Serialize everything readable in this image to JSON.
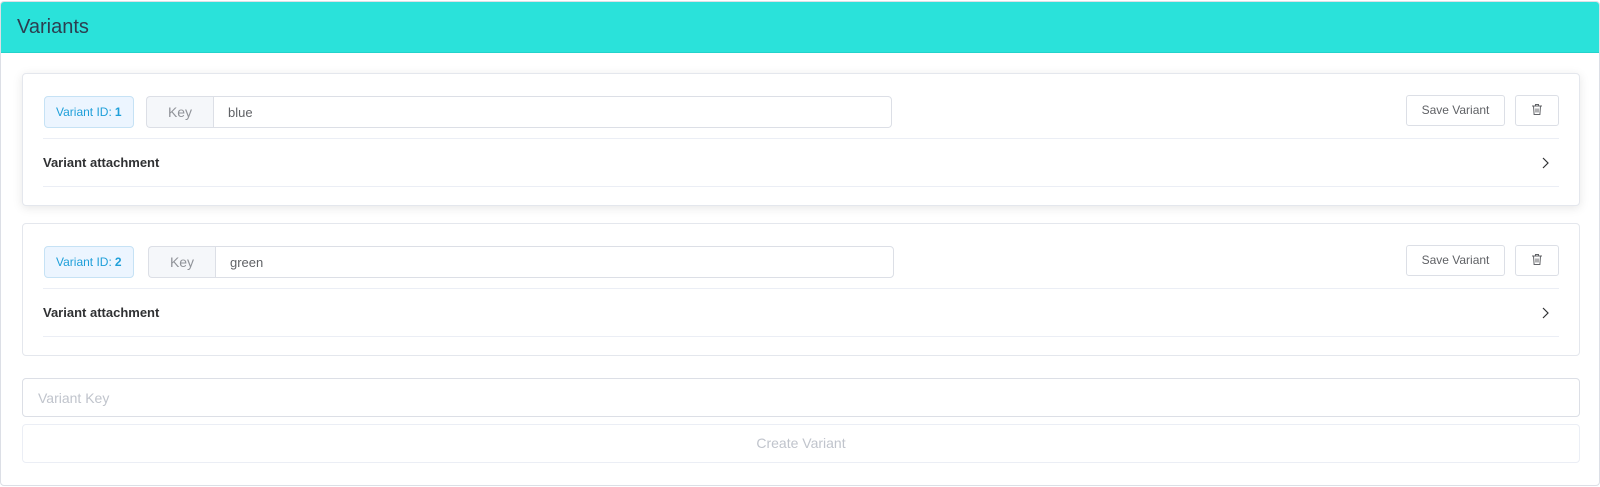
{
  "panel": {
    "title": "Variants",
    "header_color": "#2ae2da"
  },
  "variants": [
    {
      "id_label": "Variant ID:",
      "id": "1",
      "key_prefix": "Key",
      "key_value": "blue",
      "save_label": "Save Variant",
      "delete_icon": "trash-icon",
      "attachment_label": "Variant attachment",
      "attachment_icon": "chevron-right-icon"
    },
    {
      "id_label": "Variant ID:",
      "id": "2",
      "key_prefix": "Key",
      "key_value": "green",
      "save_label": "Save Variant",
      "delete_icon": "trash-icon",
      "attachment_label": "Variant attachment",
      "attachment_icon": "chevron-right-icon"
    }
  ],
  "new_variant": {
    "placeholder": "Variant Key",
    "value": "",
    "create_label": "Create Variant",
    "create_disabled": true
  }
}
